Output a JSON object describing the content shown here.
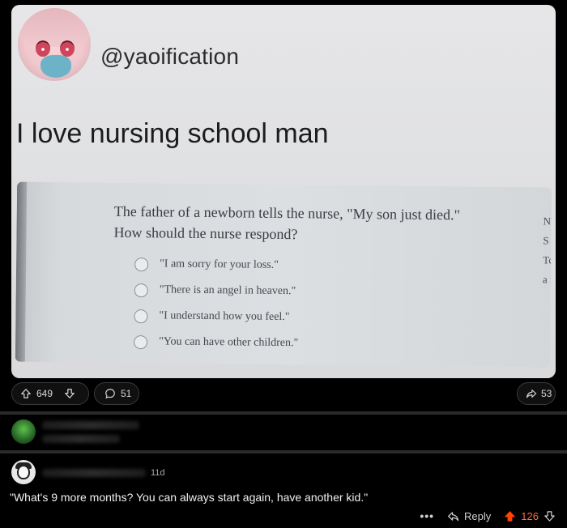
{
  "post": {
    "image": {
      "handle": "@yaoification",
      "tweet_text": "I love nursing school man",
      "quiz": {
        "question_line1": "The father of a newborn tells the nurse, \"My son just died.\"",
        "question_line2": "How should the nurse respond?",
        "options": [
          "\"I am sorry for your loss.\"",
          "\"There is an angel in heaven.\"",
          "\"I understand how you feel.\"",
          "\"You can have other children.\""
        ],
        "cut_letters": [
          "N",
          "S",
          "Tc",
          "a i"
        ]
      }
    },
    "actions": {
      "upvotes": "649",
      "comments": "51",
      "shares": "53"
    }
  },
  "comment": {
    "age": "11d",
    "text": "\"What's 9 more months? You can always start again, have another kid.\"",
    "actions": {
      "more": "•••",
      "reply_label": "Reply",
      "score": "126",
      "score_color": "#ff4500"
    }
  },
  "icons": {
    "upvote": "arrow-up-icon",
    "downvote": "arrow-down-icon",
    "comment": "speech-bubble-icon",
    "share": "share-arrow-icon",
    "reply": "reply-arrow-icon"
  }
}
